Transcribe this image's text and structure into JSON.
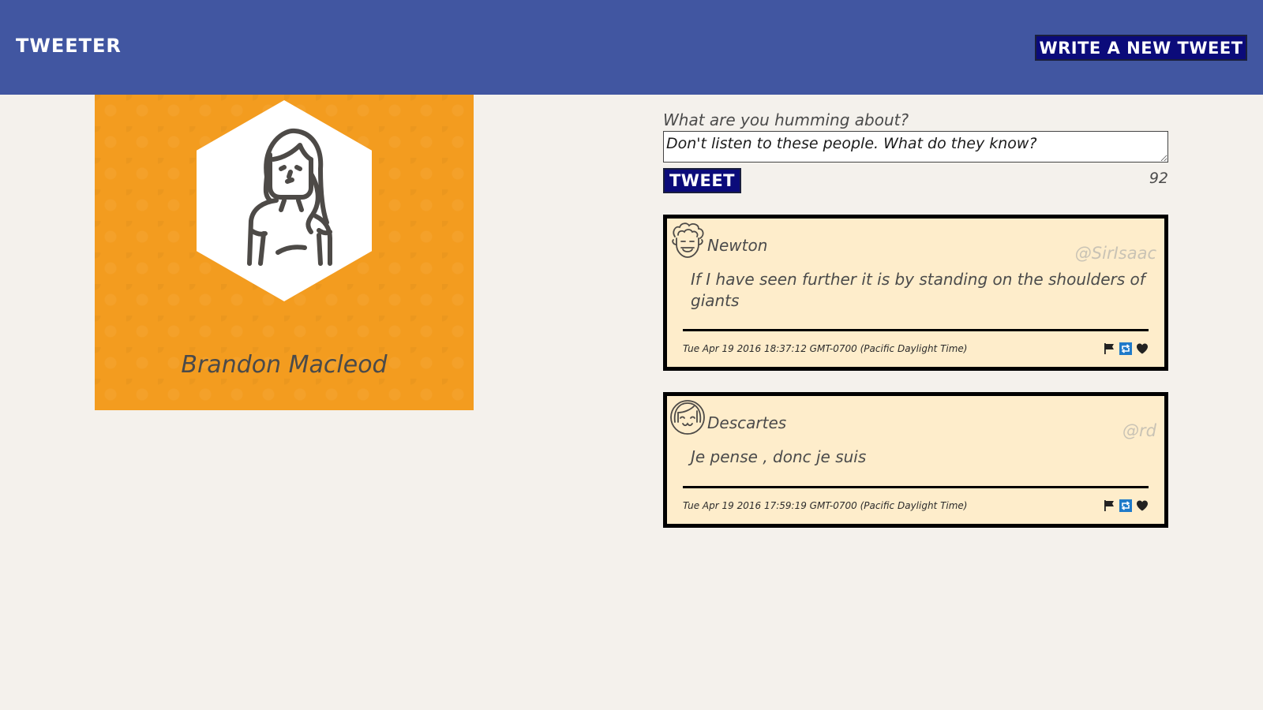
{
  "header": {
    "brand": "TWEETER",
    "compose_toggle_label": "WRITE A NEW TWEET",
    "background_color": "#4156a1"
  },
  "profile": {
    "name": "Brandon Macleod",
    "avatar_icon": "woman-avatar-icon",
    "background_color": "#f39c1f"
  },
  "compose": {
    "label": "What are you humming about?",
    "input_value": "Don't listen to these people. What do they know?",
    "submit_label": "TWEET",
    "char_counter": "92"
  },
  "tweets": [
    {
      "author": "Newton",
      "handle": "@SirIsaac",
      "avatar_icon": "curly-hair-man-avatar-icon",
      "body": "If I have seen further it is by standing on the shoulders of giants",
      "timestamp": "Tue Apr 19 2016 18:37:12 GMT-0700 (Pacific Daylight Time)",
      "actions": [
        "flag-icon",
        "retweet-icon",
        "heart-icon"
      ]
    },
    {
      "author": "Descartes",
      "handle": "@rd",
      "avatar_icon": "bob-hair-avatar-icon",
      "body": "Je pense , donc je suis",
      "timestamp": "Tue Apr 19 2016 17:59:19 GMT-0700 (Pacific Daylight Time)",
      "actions": [
        "flag-icon",
        "retweet-icon",
        "heart-icon"
      ]
    }
  ],
  "colors": {
    "page_background": "#f4f1ec",
    "tweet_background": "#feedcb",
    "button_background": "#0b0b7a"
  }
}
